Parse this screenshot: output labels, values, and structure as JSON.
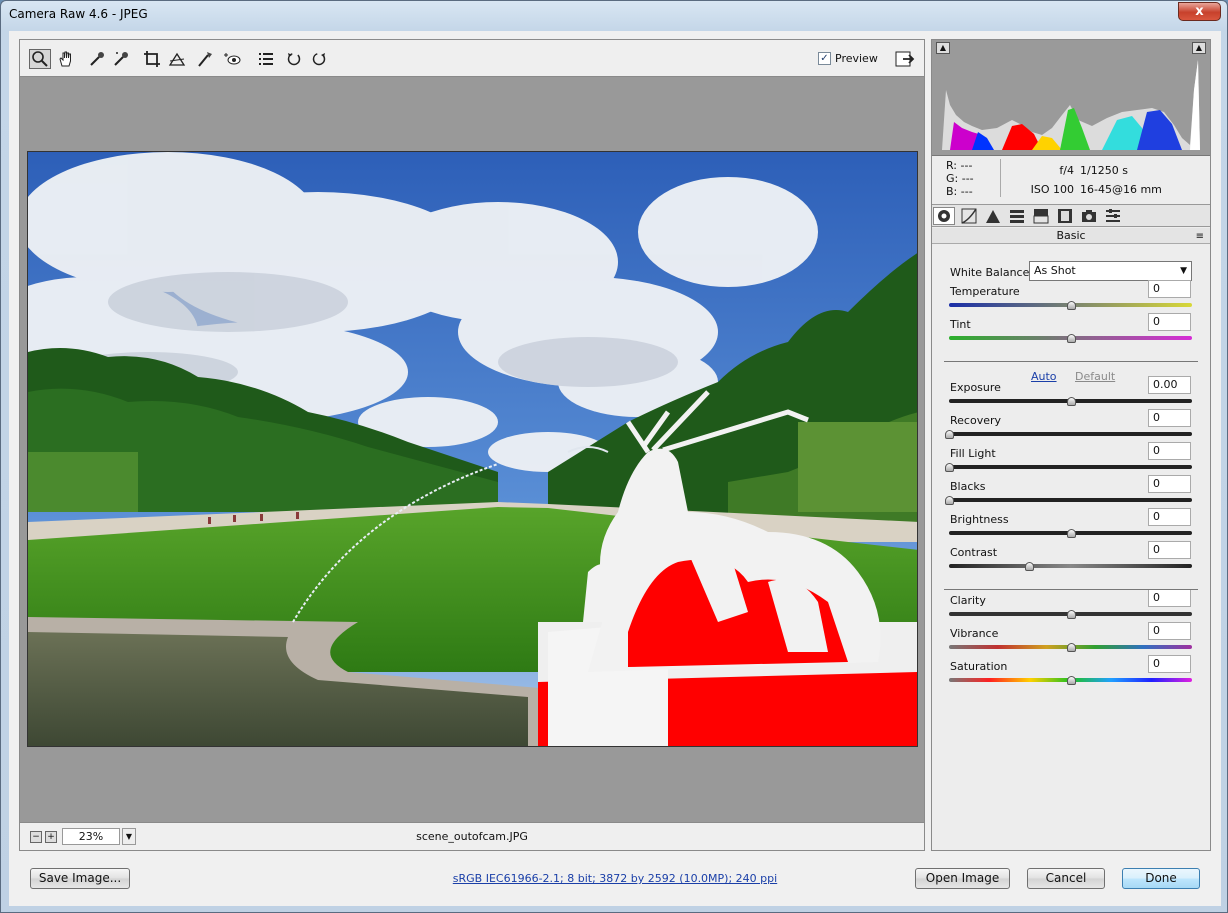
{
  "window": {
    "title": "Camera Raw 4.6  -  JPEG",
    "close": "x"
  },
  "toolbar": {
    "tools": [
      "zoom-tool",
      "hand-tool",
      "white-balance-tool",
      "color-sampler-tool",
      "crop-tool",
      "straighten-tool",
      "retouch-tool",
      "red-eye-tool",
      "preferences",
      "rotate-left",
      "rotate-right"
    ],
    "preview_label": "Preview",
    "preview_checked": true
  },
  "status": {
    "zoom_minus": "−",
    "zoom_plus": "+",
    "zoom_value": "23%",
    "filename": "scene_outofcam.JPG"
  },
  "readout": {
    "r": "R:  ---",
    "g": "G:  ---",
    "b": "B:  ---",
    "aperture": "f/4",
    "shutter": "1/1250 s",
    "iso": "ISO 100",
    "lens": "16-45@16 mm"
  },
  "panel": {
    "section": "Basic",
    "menu": "≡"
  },
  "white_balance": {
    "label": "White Balance:",
    "value": "As Shot"
  },
  "auto_label": "Auto",
  "default_label": "Default",
  "sliders": [
    {
      "label": "Temperature",
      "value": "0",
      "pos": 0.5
    },
    {
      "label": "Tint",
      "value": "0",
      "pos": 0.5
    },
    {
      "label": "Exposure",
      "value": "0.00",
      "pos": 0.5
    },
    {
      "label": "Recovery",
      "value": "0",
      "pos": 0
    },
    {
      "label": "Fill Light",
      "value": "0",
      "pos": 0
    },
    {
      "label": "Blacks",
      "value": "0",
      "pos": 0
    },
    {
      "label": "Brightness",
      "value": "0",
      "pos": 0.5
    },
    {
      "label": "Contrast",
      "value": "0",
      "pos": 0.33
    },
    {
      "label": "Clarity",
      "value": "0",
      "pos": 0.5
    },
    {
      "label": "Vibrance",
      "value": "0",
      "pos": 0.5
    },
    {
      "label": "Saturation",
      "value": "0",
      "pos": 0.5
    }
  ],
  "buttons": {
    "save": "Save Image...",
    "open": "Open Image",
    "cancel": "Cancel",
    "done": "Done"
  },
  "info_link": "sRGB IEC61966-2.1; 8 bit; 3872 by 2592 (10.0MP); 240 ppi",
  "colors": {
    "clipping_highlight": "#ff0000",
    "link": "#1a3fa8"
  }
}
